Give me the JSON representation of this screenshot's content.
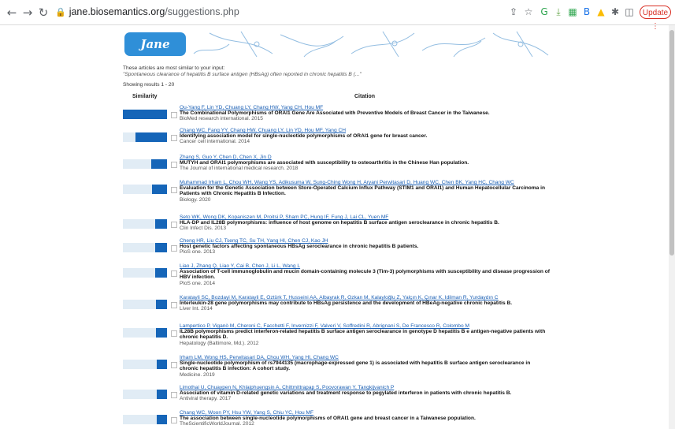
{
  "browser": {
    "url_host": "jane.biosemantics.org",
    "url_path": "/suggestions.php",
    "update_label": "Update",
    "ext_icons": [
      {
        "name": "google-icon",
        "glyph": "G",
        "color": "#2da44e"
      },
      {
        "name": "download-ext-icon",
        "glyph": "⤓",
        "color": "#6aa84f"
      },
      {
        "name": "grid-ext-icon",
        "glyph": "▦",
        "color": "#34a853"
      },
      {
        "name": "bookmark-ext-icon",
        "glyph": "B",
        "color": "#1a73e8"
      },
      {
        "name": "drive-icon",
        "glyph": "▲",
        "color": "#fbbc04"
      },
      {
        "name": "puzzle-icon",
        "glyph": "✱",
        "color": "#5f6368"
      },
      {
        "name": "sidebar-icon",
        "glyph": "◫",
        "color": "#5f6368"
      },
      {
        "name": "profile-avatar",
        "glyph": "●",
        "color": "#7b4a2a"
      }
    ]
  },
  "page": {
    "logo_text": "Jane",
    "intro_line": "These articles are most similar to your input:",
    "query_text": "\"Spontaneous clearance of hepatitis B surface antigen (HBsAg) often reported in chronic hepatitis B (...\"",
    "showing": "Showing results 1 - 20",
    "col_similarity": "Similarity",
    "col_citation": "Citation"
  },
  "results": [
    {
      "score": 1.0,
      "authors": "Ou-Yang F, Lin YD, Chuang LY, Chang HW, Yang CH, Hou MF",
      "title": "The Combinational Polymorphisms of ORAI1 Gene Are Associated with Preventive Models of Breast Cancer in the Taiwanese.",
      "journal": "BioMed research international. 2015"
    },
    {
      "score": 0.72,
      "authors": "Chang WC, Fang YY, Chang HW, Chuang LY, Lin YD, Hou MF, Yang CH",
      "title": "Identifying association model for single-nucleotide polymorphisms of ORAI1 gene for breast cancer.",
      "journal": "Cancer cell international. 2014"
    },
    {
      "score": 0.36,
      "authors": "Zhang S, Guo Y, Chen D, Chen X, Jin D",
      "title": "MUTYH and ORAI1 polymorphisms are associated with susceptibility to osteoarthritis in the Chinese Han population.",
      "journal": "The Journal of international medical research. 2018"
    },
    {
      "score": 0.34,
      "authors": "Muhammad Irham L, Chou WH, Wang YS, Adikusuma W, Sung-Ching Wong H, Aryani Perwitasari D, Huang WC, Chen BK, Yang HC, Chang WC",
      "title": "Evaluation for the Genetic Association between Store-Operated Calcium Influx Pathway (STIM1 and ORAI1) and Human Hepatocellular Carcinoma in Patients with Chronic Hepatitis B Infection.",
      "journal": "Biology. 2020"
    },
    {
      "score": 0.27,
      "authors": "Seto WK, Wong DK, Kopaniszen M, Proitsi P, Sham PC, Hung IF, Fung J, Lai CL, Yuen MF",
      "title": "HLA-DP and IL28B polymorphisms: influence of host genome on hepatitis B surface antigen seroclearance in chronic hepatitis B.",
      "journal": "Clin Infect Dis. 2013"
    },
    {
      "score": 0.26,
      "authors": "Cheng HR, Liu CJ, Tseng TC, Su TH, Yang HI, Chen CJ, Kao JH",
      "title": "Host genetic factors affecting spontaneous HBsAg seroclearance in chronic hepatitis B patients.",
      "journal": "PloS one. 2013"
    },
    {
      "score": 0.26,
      "authors": "Liao J, Zhang Q, Liao Y, Cai B, Chen J, Li L, Wang L",
      "title": "Association of T-cell immunoglobulin and mucin domain-containing molecule 3 (Tim-3) polymorphisms with susceptibility and disease progression of HBV infection.",
      "journal": "PloS one. 2014"
    },
    {
      "score": 0.25,
      "authors": "Karatayli SC, Bozdayi M, Karatayli E, Öztürk T, Husseini AA, Albayrak R, Özkan M, Kalayloğlu Z, Yalçın K, Çınar K, Idilman R, Yurdaydın C",
      "title": "Interleukin-28 gene polymorphisms may contribute to HBsAg persistence and the development of HBeAg-negative chronic hepatitis B.",
      "journal": "Liver Int. 2014"
    },
    {
      "score": 0.25,
      "authors": "Lampertico P, Viganò M, Cheroni C, Facchetti F, Invernizzi F, Valveri V, Soffredini R, Abrignani S, De Francesco R, Colombo M",
      "title": "IL28B polymorphisms predict interferon-related hepatitis B surface antigen seroclearance in genotype D hepatitis B e antigen-negative patients with chronic hepatitis D.",
      "journal": "Hepatology (Baltimore, Md.). 2012"
    },
    {
      "score": 0.24,
      "authors": "Irham LM, Wong HS, Perwitasari DA, Chou WH, Yang HI, Chang WC",
      "title": "Single-nucleotide polymorphism of rs7944135 (macrophage-expressed gene 1) is associated with hepatitis B surface antigen seroclearance in chronic hepatitis B infection: A cohort study.",
      "journal": "Medicine. 2019"
    },
    {
      "score": 0.24,
      "authors": "Limothai U, Chuaypen N, Khlaiphuengsin A, Chittmittrapap S, Poovorawan Y, Tangkijvanich P",
      "title": "Association of vitamin D-related genetic variations and treatment response to pegylated interferon in patients with chronic hepatitis B.",
      "journal": "Antiviral therapy. 2017"
    },
    {
      "score": 0.23,
      "authors": "Chang WC, Woon PY, Hsu YW, Yang S, Chiu YC, Hou MF",
      "title": "The association between single-nucleotide polymorphisms of ORAI1 gene and breast cancer in a Taiwanese population.",
      "journal": "TheScientificWorldJournal. 2012"
    }
  ]
}
